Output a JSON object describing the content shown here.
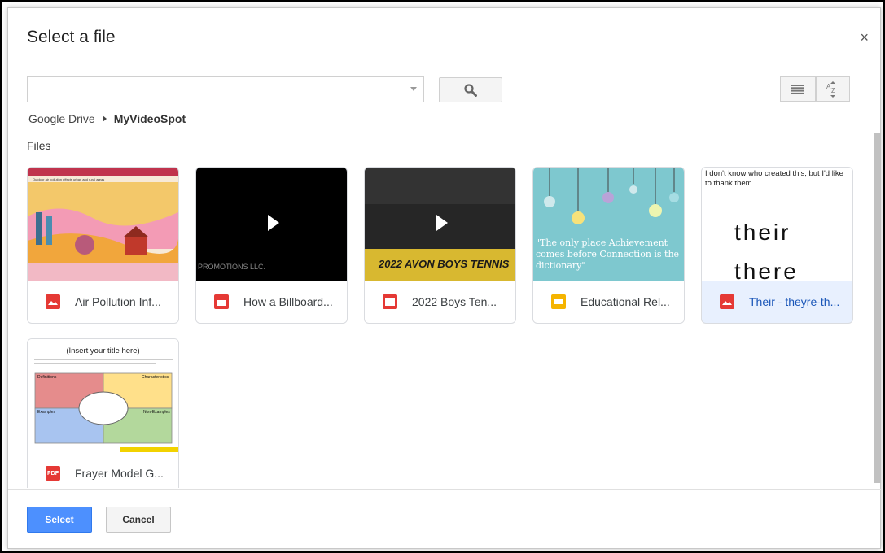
{
  "dialog": {
    "title": "Select a file",
    "close_label": "×"
  },
  "search": {
    "value": "",
    "placeholder": ""
  },
  "breadcrumb": {
    "root": "Google Drive",
    "current": "MyVideoSpot"
  },
  "files_heading": "Files",
  "files": [
    {
      "name": "Air Pollution Inf...",
      "type_icon": "image-icon",
      "thumb_text": "Outdoor air pollution effects urban and rural areas"
    },
    {
      "name": "How a Billboard...",
      "type_icon": "video-icon",
      "thumb_text": "PROMOTIONS LLC."
    },
    {
      "name": "2022 Boys Ten...",
      "type_icon": "video-icon",
      "thumb_text": "2022 AVON BOYS TENNIS"
    },
    {
      "name": "Educational Rel...",
      "type_icon": "slides-icon",
      "thumb_text": "\"The only place Achievement comes before Connection is the dictionary\""
    },
    {
      "name": "Their - theyre-th...",
      "type_icon": "image-icon",
      "thumb_text": "I don't know who created this, but I'd like to thank them.",
      "word1": "their",
      "word2": "there",
      "selected": true
    },
    {
      "name": "Frayer Model G...",
      "type_icon": "pdf-icon",
      "thumb_text": "(Insert your title here)",
      "quad_labels": [
        "Definitions",
        "Characteristics",
        "Examples",
        "Non-Examples"
      ]
    }
  ],
  "buttons": {
    "select": "Select",
    "cancel": "Cancel"
  },
  "colors": {
    "primary": "#4d90fe",
    "selected_bg": "#e8f0fe",
    "file_red": "#e53935",
    "slides_yellow": "#f5b400"
  }
}
